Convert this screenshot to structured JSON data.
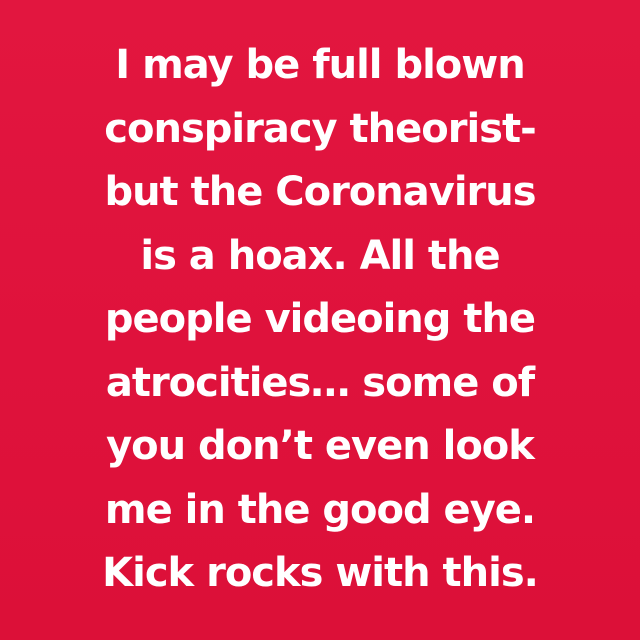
{
  "post": {
    "background_color": "#e0133d",
    "text_color": "#ffffff",
    "lines": [
      "I may be full blown",
      "conspiracy theorist-",
      "but the Coronavirus",
      "is a hoax. All the",
      "people videoing the",
      "atrocities… some of",
      "you don’t even look",
      "me in the good eye.",
      "Kick rocks with this."
    ]
  }
}
